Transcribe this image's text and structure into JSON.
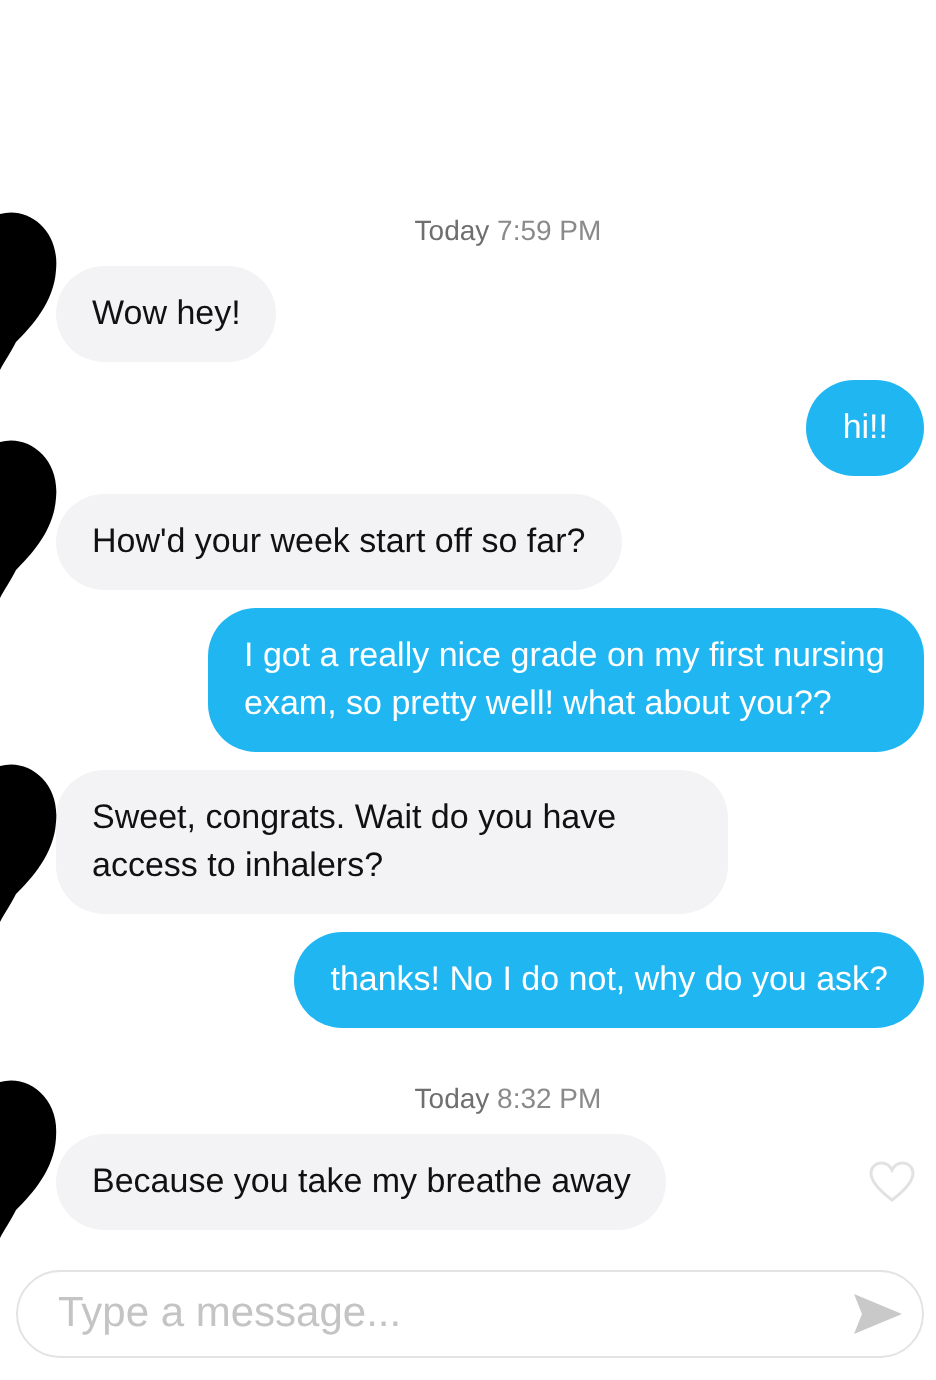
{
  "messages": [
    {
      "kind": "timestamp",
      "day": "Today",
      "time": "7:59 PM"
    },
    {
      "kind": "received",
      "text": "Wow hey!"
    },
    {
      "kind": "sent",
      "text": "hi!!"
    },
    {
      "kind": "received",
      "text": "How'd your week start off so far?"
    },
    {
      "kind": "sent",
      "text": "I got a really nice grade on my first nursing exam, so pretty well! what about you??"
    },
    {
      "kind": "received",
      "text": "Sweet, congrats. Wait do you have access to inhalers?"
    },
    {
      "kind": "sent",
      "text": "thanks! No I do not, why do you ask?"
    },
    {
      "kind": "timestamp",
      "day": "Today",
      "time": "8:32 PM"
    },
    {
      "kind": "received",
      "text": "Because you take my breathe away",
      "liked": false
    }
  ],
  "composer": {
    "placeholder": "Type a message..."
  }
}
